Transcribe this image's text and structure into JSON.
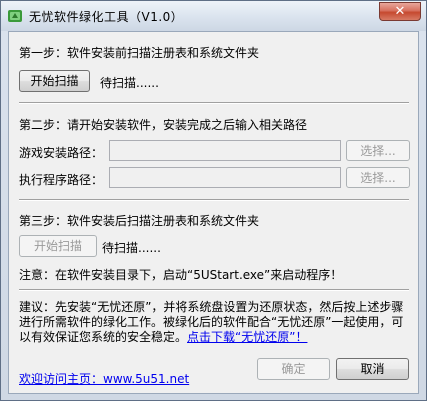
{
  "window": {
    "title": "无忧软件绿化工具（V1.0）",
    "close_glyph": "✕",
    "icon": "app-icon"
  },
  "step1": {
    "label": "第一步：软件安装前扫描注册表和系统文件夹",
    "button": "开始扫描",
    "status": "待扫描......"
  },
  "step2": {
    "label": "第二步：请开始安装软件，安装完成之后输入相关路径",
    "game_path_label": "游戏安装路径：",
    "game_path_value": "",
    "exe_path_label": "执行程序路径：",
    "exe_path_value": "",
    "browse_button": "选择..."
  },
  "step3": {
    "label": "第三步：软件安装后扫描注册表和系统文件夹",
    "button": "开始扫描",
    "status": "待扫描......",
    "note": "注意：在软件安装目录下，启动“5UStart.exe”来启动程序！"
  },
  "advice": {
    "text": "建议：先安装“无忧还原”，并将系统盘设置为还原状态，然后按上述步骤进行所需软件的绿化工作。被绿化后的软件配合“无忧还原”一起使用，可以有效保证您系统的安全稳定。",
    "link": "点击下载“无忧还原”！"
  },
  "footer": {
    "homepage_link": "欢迎访问主页：www.5u51.net",
    "ok_button": "确定",
    "cancel_button": "取消"
  },
  "colors": {
    "link": "#0000ee",
    "disabled_text": "#9a9a9a",
    "close_button": "#c6492f"
  }
}
